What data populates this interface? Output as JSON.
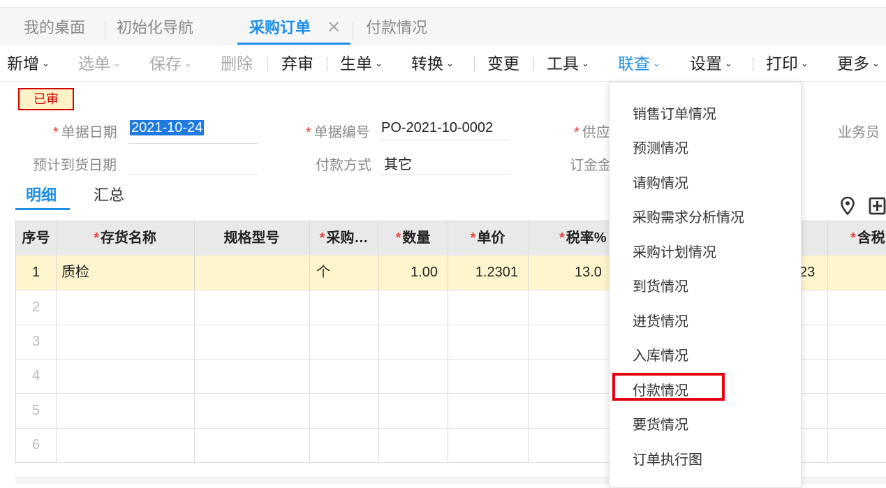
{
  "tabs": [
    {
      "label": "我的桌面"
    },
    {
      "label": "初始化导航"
    },
    {
      "label": "采购订单",
      "active": true,
      "close": "✕"
    },
    {
      "label": "付款情况"
    }
  ],
  "toolbar": {
    "add": "新增",
    "select": "选单",
    "save": "保存",
    "delete": "删除",
    "abandon": "弃审",
    "generate": "生单",
    "convert": "转换",
    "change": "变更",
    "tools": "工具",
    "query": "联查",
    "settings": "设置",
    "print": "打印",
    "more": "更多",
    "chevron": "⌄"
  },
  "status": "已审",
  "form": {
    "req_mark": "*",
    "date_label": "单据日期",
    "date_value": "2021-10-24",
    "no_label": "单据编号",
    "no_value": "PO-2021-10-0002",
    "supplier_label": "供应",
    "salesman_label": "业务员",
    "expected_label": "预计到货日期",
    "expected_value": "",
    "payment_label": "付款方式",
    "payment_value": "其它",
    "deposit_label": "订金金"
  },
  "subtabs": [
    "明细",
    "汇总"
  ],
  "table": {
    "headers": [
      {
        "label": "序号",
        "req": false
      },
      {
        "label": "存货名称",
        "req": true
      },
      {
        "label": "规格型号",
        "req": false
      },
      {
        "label": "采购…",
        "req": true
      },
      {
        "label": "数量",
        "req": true
      },
      {
        "label": "单价",
        "req": true
      },
      {
        "label": "税率%",
        "req": true
      },
      {
        "label": "含税",
        "req": true
      }
    ],
    "rows": [
      {
        "no": "1",
        "name": "质检",
        "spec": "",
        "unit": "个",
        "qty": "1.00",
        "price": "1.2301",
        "tax": "13.0",
        "amt": "23"
      },
      {
        "no": "2"
      },
      {
        "no": "3"
      },
      {
        "no": "4"
      },
      {
        "no": "5"
      },
      {
        "no": "6"
      }
    ]
  },
  "dropdown": {
    "items": [
      "销售订单情况",
      "预测情况",
      "请购情况",
      "采购需求分析情况",
      "采购计划情况",
      "到货情况",
      "进货情况",
      "入库情况",
      "付款情况",
      "要货情况",
      "订单执行图"
    ],
    "highlighted": "付款情况"
  },
  "colors": {
    "accent": "#1e8ee8",
    "status_border": "#d40000",
    "status_bg": "#fff2c7",
    "highlight_border": "#e60012",
    "selected_row": "#fff5cc"
  }
}
